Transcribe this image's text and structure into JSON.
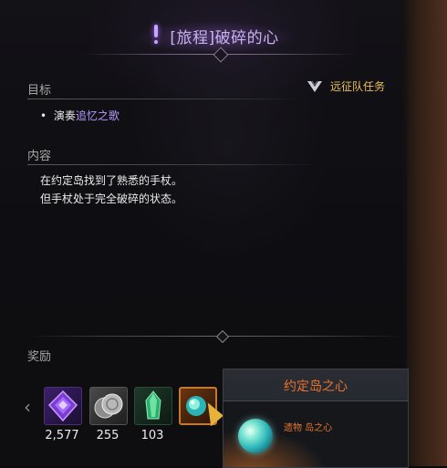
{
  "header": {
    "title": "[旅程]破碎的心"
  },
  "objective": {
    "label": "目标",
    "bullet": "•",
    "prefix": "演奏",
    "highlight": "追忆之歌",
    "highlight_color": "#b79bff"
  },
  "expedition": {
    "label": "远征队任务",
    "color": "#e7c15a"
  },
  "content": {
    "label": "内容",
    "line1": "在约定岛找到了熟悉的手杖。",
    "line2": "但手杖处于完全破碎的状态。"
  },
  "rewards": {
    "label": "奖励",
    "items": [
      {
        "icon": "purple-gem-icon",
        "count": "2,577"
      },
      {
        "icon": "silver-coins-icon",
        "count": "255"
      },
      {
        "icon": "green-crystal-icon",
        "count": "103"
      },
      {
        "icon": "orb-icon",
        "count": ""
      }
    ]
  },
  "tooltip": {
    "title": "约定岛之心",
    "subtitle": "遗物 岛之心",
    "accent_color": "#e8732e"
  }
}
